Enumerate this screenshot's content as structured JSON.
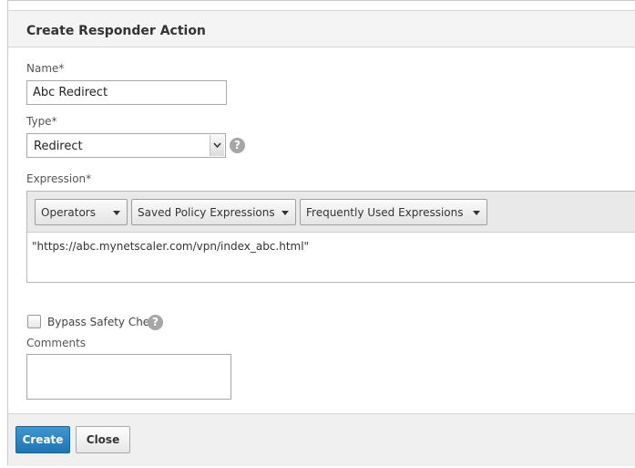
{
  "dialog": {
    "title": "Create Responder Action"
  },
  "form": {
    "name_label": "Name*",
    "name_value": "Abc Redirect",
    "type_label": "Type*",
    "type_value": "Redirect",
    "type_help": "?",
    "expression_label": "Expression*",
    "expression_toolbar": {
      "operators": "Operators",
      "saved": "Saved Policy Expressions",
      "frequent": "Frequently Used Expressions"
    },
    "expression_value": "\"https://abc.mynetscaler.com/vpn/index_abc.html\"",
    "bypass_label": "Bypass Safety Check",
    "bypass_checked": false,
    "bypass_help": "?",
    "comments_label": "Comments",
    "comments_value": ""
  },
  "footer": {
    "create_label": "Create",
    "close_label": "Close"
  },
  "colors": {
    "primary_button": "#2584c4",
    "header_bg": "#f4f4f4",
    "help_icon": "#a6a6a6"
  },
  "icons": [
    "help-icon",
    "chevron-down-icon"
  ]
}
